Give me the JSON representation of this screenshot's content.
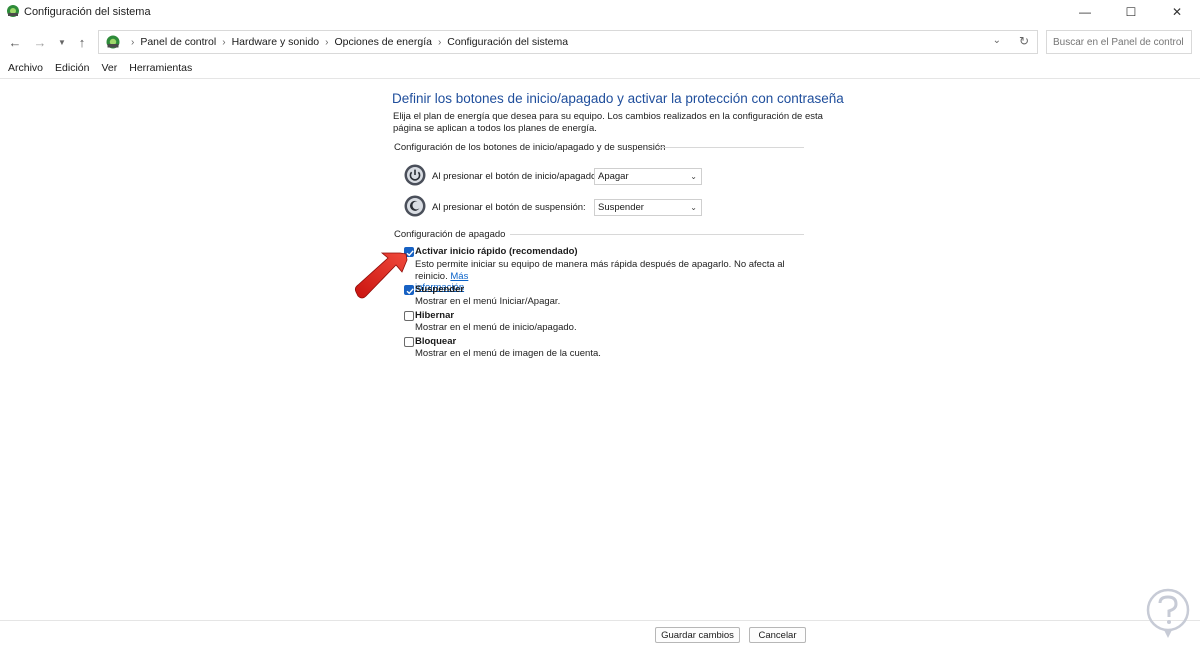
{
  "window": {
    "title": "Configuración del sistema",
    "min_glyph": "—",
    "max_glyph": "☐",
    "close_glyph": "✕"
  },
  "nav": {
    "breadcrumbs": [
      "Panel de control",
      "Hardware y sonido",
      "Opciones de energía",
      "Configuración del sistema"
    ],
    "search_placeholder": "Buscar en el Panel de control"
  },
  "menu": [
    "Archivo",
    "Edición",
    "Ver",
    "Herramientas"
  ],
  "main": {
    "heading": "Definir los botones de inicio/apagado y activar la protección con contraseña",
    "intro": "Elija el plan de energía que desea para su equipo. Los cambios realizados en la configuración de esta página se aplican a todos los planes de energía.",
    "buttons_group": {
      "title": "Configuración de los botones de inicio/apagado y de suspensión",
      "rows": [
        {
          "label": "Al presionar el botón de inicio/apagado:",
          "value": "Apagar"
        },
        {
          "label": "Al presionar el botón de suspensión:",
          "value": "Suspender"
        }
      ]
    },
    "shutdown_group": {
      "title": "Configuración de apagado",
      "options": [
        {
          "label": "Activar inicio rápido (recomendado)",
          "checked": true,
          "desc": "Esto permite iniciar su equipo de manera más rápida después de apagarlo. No afecta al reinicio.",
          "link_part1": "Más",
          "link_part2": "información"
        },
        {
          "label": "Suspender",
          "checked": true,
          "desc": "Mostrar en el menú Iniciar/Apagar."
        },
        {
          "label": "Hibernar",
          "checked": false,
          "desc": "Mostrar en el menú de inicio/apagado."
        },
        {
          "label": "Bloquear",
          "checked": false,
          "desc": "Mostrar en el menú de imagen de la cuenta."
        }
      ]
    }
  },
  "footer": {
    "save_label": "Guardar cambios",
    "cancel_label": "Cancelar"
  },
  "colors": {
    "heading": "#1f4e9c",
    "checkbox_checked": "#1761c3",
    "link": "#0a63c9",
    "arrow": "#e8201c"
  },
  "icons": {
    "app": "control-panel-icon",
    "power": "power-button-icon",
    "sleep": "sleep-button-icon",
    "search": "search-icon",
    "refresh": "refresh-icon",
    "annotation": "red-arrow-annotation"
  }
}
